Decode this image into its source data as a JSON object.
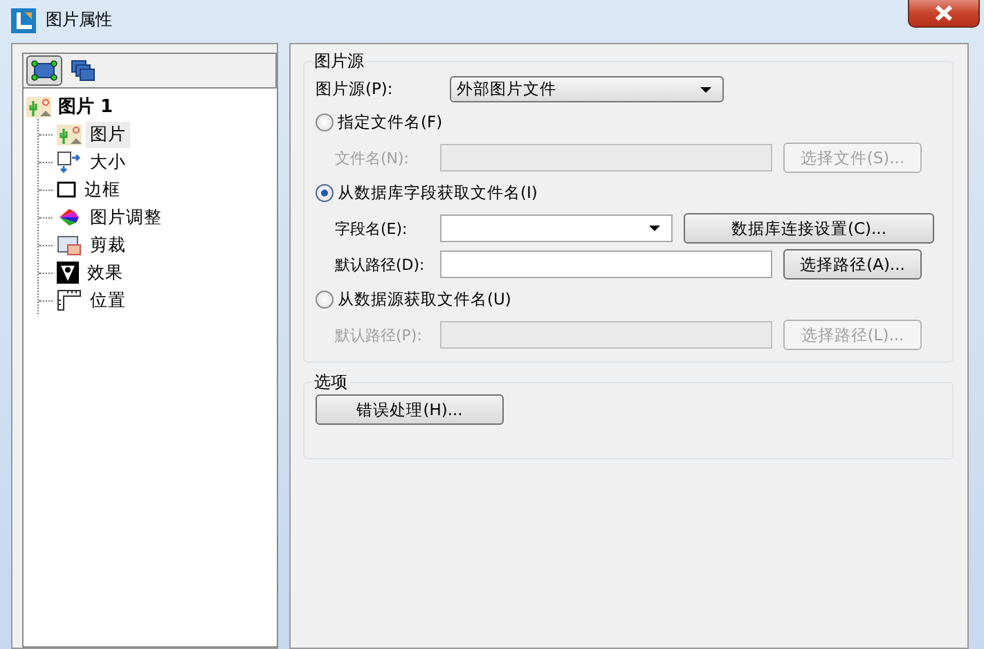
{
  "window": {
    "title": "图片属性"
  },
  "toolbar": [
    {
      "kind": "frame",
      "selected": true
    },
    {
      "kind": "layers",
      "selected": false
    }
  ],
  "tree": {
    "label": "图片 1",
    "children": [
      {
        "label": "图片",
        "kind": "picture",
        "selected": true
      },
      {
        "label": "大小",
        "kind": "size",
        "selected": false
      },
      {
        "label": "边框",
        "kind": "border",
        "selected": false
      },
      {
        "label": "图片调整",
        "kind": "adjust",
        "selected": false
      },
      {
        "label": "剪裁",
        "kind": "crop",
        "selected": false
      },
      {
        "label": "效果",
        "kind": "effect",
        "selected": false
      },
      {
        "label": "位置",
        "kind": "position",
        "selected": false
      }
    ]
  },
  "source_group": {
    "title": "图片源",
    "source": {
      "label": "图片源(P):",
      "value": "外部图片文件"
    },
    "options": [
      {
        "label": "指定文件名(F)",
        "selected": false,
        "rows": [
          {
            "kind": "text",
            "label": "文件名(N):",
            "disabled": true,
            "button": "选择文件(S)..."
          }
        ]
      },
      {
        "label": "从数据库字段获取文件名(I)",
        "selected": true,
        "rows": [
          {
            "kind": "dropdown",
            "label": "字段名(E):",
            "disabled": false,
            "button": "数据库连接设置(C)..."
          },
          {
            "kind": "text",
            "label": "默认路径(D):",
            "disabled": false,
            "button": "选择路径(A)..."
          }
        ]
      },
      {
        "label": "从数据源获取文件名(U)",
        "selected": false,
        "rows": [
          {
            "kind": "text",
            "label": "默认路径(P):",
            "disabled": true,
            "button": "选择路径(L)..."
          }
        ]
      }
    ]
  },
  "options_group": {
    "title": "选项",
    "button": "错误处理(H)..."
  }
}
